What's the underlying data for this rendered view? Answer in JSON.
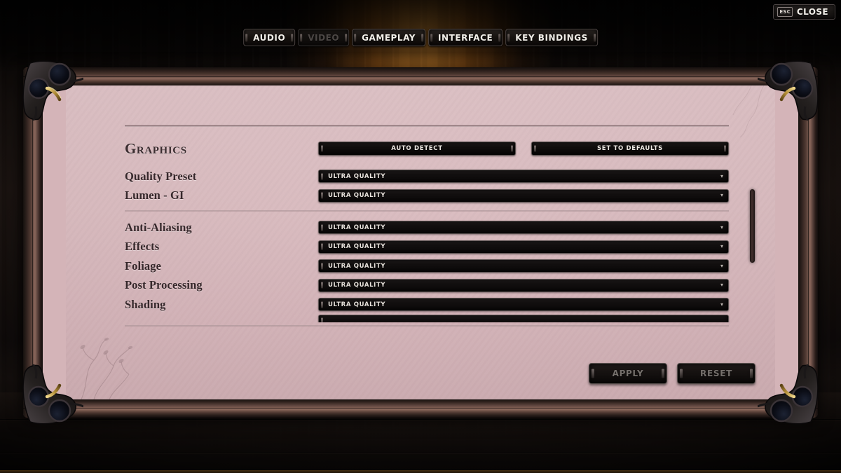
{
  "window": {
    "close_button": {
      "key": "ESC",
      "label": "CLOSE"
    }
  },
  "tabs": [
    {
      "id": "audio",
      "label": "AUDIO",
      "active": false
    },
    {
      "id": "video",
      "label": "VIDEO",
      "active": true
    },
    {
      "id": "gameplay",
      "label": "GAMEPLAY",
      "active": false
    },
    {
      "id": "interface",
      "label": "INTERFACE",
      "active": false
    },
    {
      "id": "key-bindings",
      "label": "KEY BINDINGS",
      "active": false
    }
  ],
  "section": {
    "title": "Graphics",
    "auto_detect_label": "AUTO DETECT",
    "set_to_defaults_label": "SET TO DEFAULTS"
  },
  "settings_group_1": [
    {
      "label": "Quality Preset",
      "value": "ULTRA QUALITY",
      "arrow": "chevron-down-icon"
    },
    {
      "label": "Lumen - GI",
      "value": "ULTRA QUALITY",
      "arrow": "chevron-down-icon"
    }
  ],
  "settings_group_2": [
    {
      "label": "Anti-Aliasing",
      "value": "ULTRA QUALITY",
      "arrow": "chevron-down-icon"
    },
    {
      "label": "Effects",
      "value": "ULTRA QUALITY",
      "arrow": "chevron-down-icon"
    },
    {
      "label": "Foliage",
      "value": "ULTRA QUALITY",
      "arrow": "chevron-down-icon"
    },
    {
      "label": "Post Processing",
      "value": "ULTRA QUALITY",
      "arrow": "chevron-down-icon"
    },
    {
      "label": "Shading",
      "value": "ULTRA QUALITY",
      "arrow": "chevron-down-icon"
    }
  ],
  "footer": {
    "apply_label": "APPLY",
    "reset_label": "RESET"
  },
  "colors": {
    "panel_parchment": "#d8b9bd",
    "frame_wood": "#8a675b",
    "control_dark": "#100d0c",
    "text_dark": "#36282b",
    "text_light": "#efeae4",
    "disabled_text": "#75706c",
    "glow_orange": "#ffa83c"
  }
}
